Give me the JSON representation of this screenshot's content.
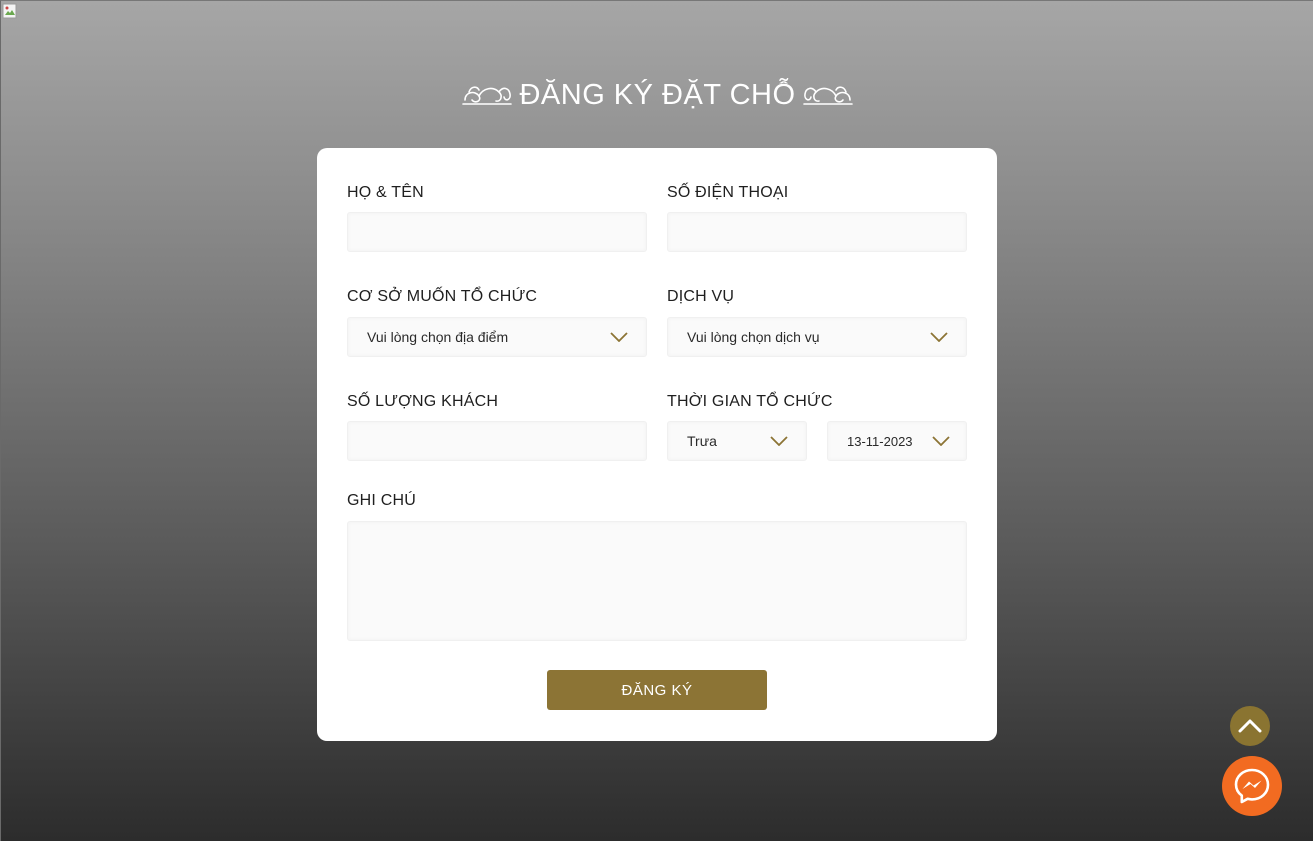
{
  "header": {
    "title": "ĐĂNG KÝ ĐẶT CHỖ"
  },
  "form": {
    "full_name_label": "HỌ & TÊN",
    "full_name_value": "",
    "phone_label": "SỐ ĐIỆN THOẠI",
    "phone_value": "",
    "venue_label": "CƠ SỞ MUỐN TỔ CHỨC",
    "venue_selected": "Vui lòng chọn địa điểm",
    "service_label": "DỊCH VỤ",
    "service_selected": "Vui lòng chọn dịch vụ",
    "guests_label": "SỐ LƯỢNG KHÁCH",
    "guests_value": "",
    "time_label": "THỜI GIAN TỔ CHỨC",
    "session_selected": "Trưa",
    "date_selected": "13-11-2023",
    "note_label": "GHI CHÚ",
    "note_value": "",
    "submit_label": "ĐĂNG KÝ"
  },
  "icons": {
    "ornament_left": "flourish-ornament-icon",
    "ornament_right": "flourish-ornament-icon",
    "dropdown": "chevron-down-icon",
    "scroll_top": "chevron-up-icon",
    "messenger": "messenger-icon"
  },
  "colors": {
    "accent": "#8c7435",
    "messenger": "#f26b21",
    "card": "#ffffff",
    "field_bg": "#fafafa"
  }
}
